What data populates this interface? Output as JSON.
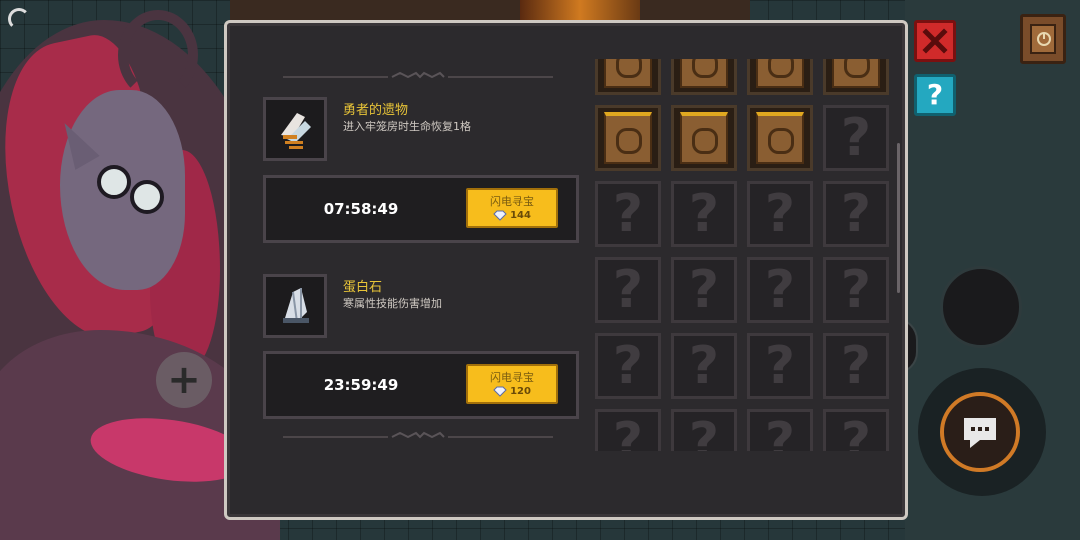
{
  "panel": {
    "items": [
      {
        "name": "勇者的遗物",
        "desc": "进入牢笼房时生命恢复1格",
        "icon": "relic-wings-icon",
        "timer": "07:58:49",
        "button_label": "闪电寻宝",
        "cost": "144"
      },
      {
        "name": "蛋白石",
        "desc": "寒属性技能伤害增加",
        "icon": "opal-crystal-icon",
        "timer": "23:59:49",
        "button_label": "闪电寻宝",
        "cost": "120"
      }
    ],
    "grid": {
      "rows": [
        [
          "scroll-glyph-1",
          "scroll-glyph-2",
          "scroll-glyph-3",
          "scroll-glyph-4"
        ],
        [
          "scroll-glyph-5",
          "scroll-glyph-6",
          "scroll-glyph-7",
          "locked"
        ],
        [
          "locked",
          "locked",
          "locked",
          "locked"
        ],
        [
          "locked",
          "locked",
          "locked",
          "locked"
        ],
        [
          "locked",
          "locked",
          "locked",
          "locked"
        ],
        [
          "locked",
          "locked",
          "locked",
          "locked"
        ]
      ],
      "locked_symbol": "?"
    }
  },
  "hud": {
    "close_icon": "close-x-icon",
    "help_label": "?",
    "book_icon": "book-icon",
    "chat_icon": "chat-bubble-icon",
    "plus_label": "+"
  },
  "colors": {
    "accent_gold": "#f7bd1c",
    "item_name": "#e8c438",
    "close_red": "#d02a2a",
    "help_cyan": "#24a8c0"
  }
}
